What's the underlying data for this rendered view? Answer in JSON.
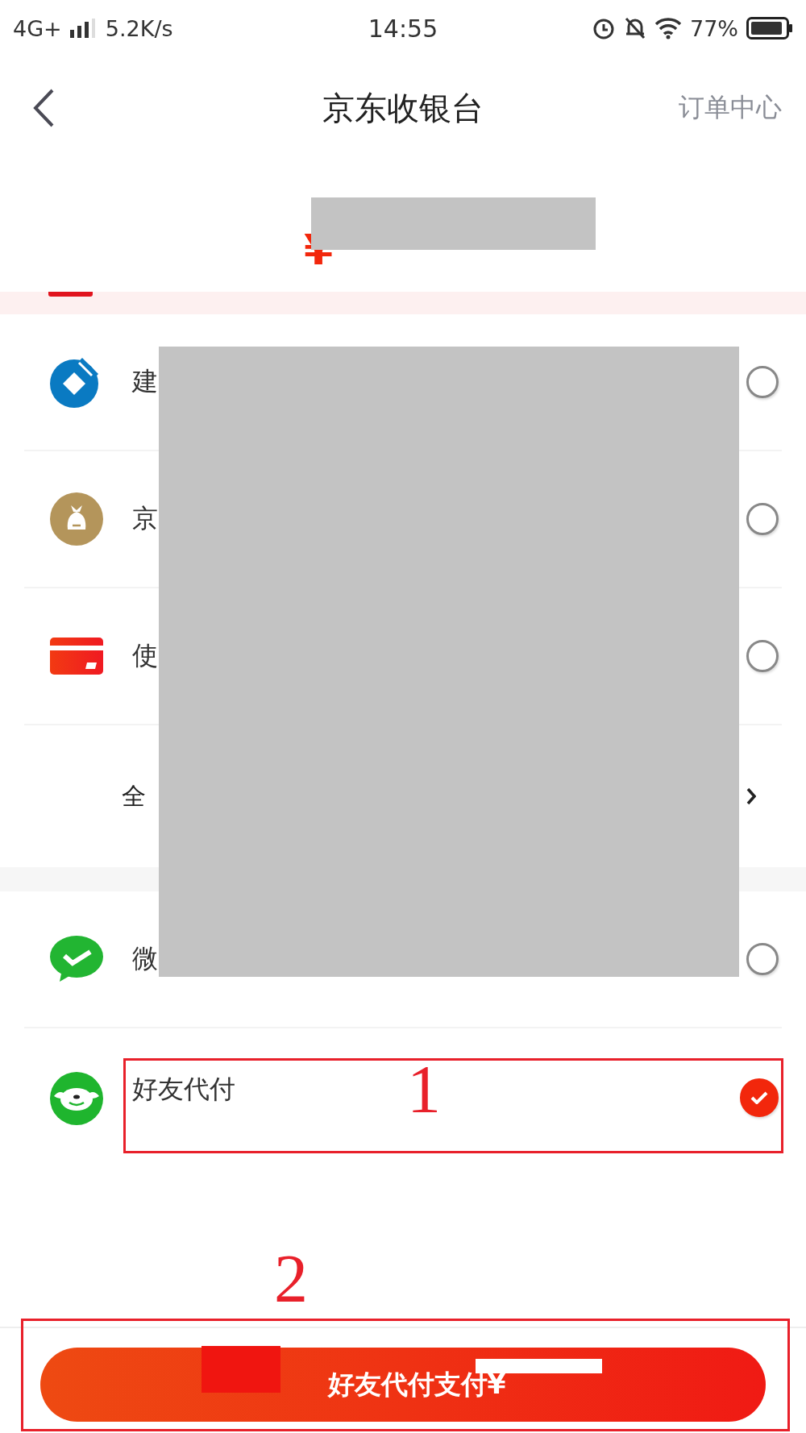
{
  "status_bar": {
    "network": "4G+",
    "speed": "5.2K/s",
    "time": "14:55",
    "battery": "77%"
  },
  "header": {
    "title": "京东收银台",
    "action": "订单中心"
  },
  "amount": {
    "currency": "¥"
  },
  "bank_methods": [
    {
      "kind": "bank",
      "label": "建",
      "selected": false
    },
    {
      "kind": "wallet",
      "label": "京",
      "selected": false
    },
    {
      "kind": "card",
      "label": "使",
      "selected": false
    }
  ],
  "all_methods": {
    "label": "全"
  },
  "other_methods": [
    {
      "kind": "wechat",
      "label": "微",
      "selected": false
    },
    {
      "kind": "friend",
      "label": "好友代付",
      "selected": true
    }
  ],
  "pay_button": {
    "label": "好友代付支付¥"
  },
  "annotations": [
    "1",
    "2"
  ]
}
